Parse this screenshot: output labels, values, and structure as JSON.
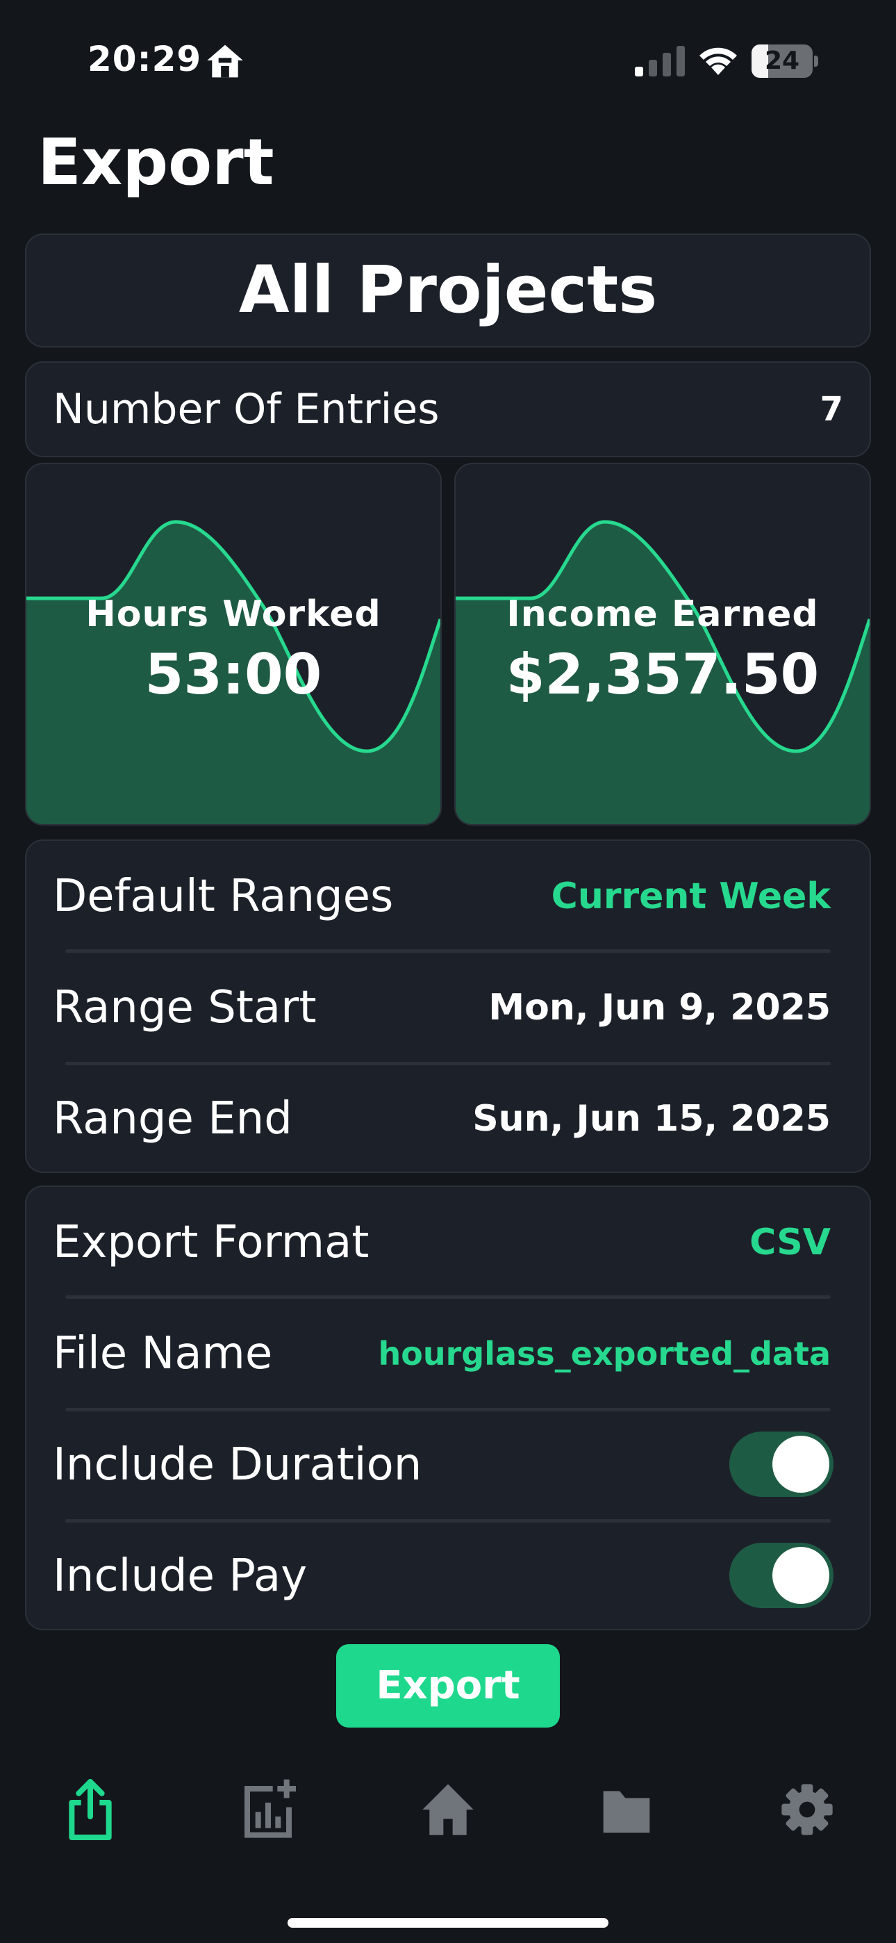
{
  "status_bar": {
    "time": "20:29",
    "battery_level": "24"
  },
  "page_title": "Export",
  "project_selector": {
    "title": "All Projects"
  },
  "entries": {
    "label": "Number Of Entries",
    "value": "7"
  },
  "stats": [
    {
      "label": "Hours Worked",
      "value": "53:00"
    },
    {
      "label": "Income Earned",
      "value": "$2,357.50"
    }
  ],
  "range": {
    "default_label": "Default Ranges",
    "default_value": "Current Week",
    "start_label": "Range Start",
    "start_value": "Mon, Jun 9, 2025",
    "end_label": "Range End",
    "end_value": "Sun, Jun 15, 2025"
  },
  "export_options": {
    "format_label": "Export Format",
    "format_value": "CSV",
    "file_label": "File Name",
    "file_value": "hourglass_exported_data",
    "duration_label": "Include Duration",
    "duration_on": true,
    "pay_label": "Include Pay",
    "pay_on": true
  },
  "export_button": "Export",
  "tab_bar": [
    {
      "icon": "share-icon",
      "active": true
    },
    {
      "icon": "add-chart-icon",
      "active": false
    },
    {
      "icon": "home-icon",
      "active": false
    },
    {
      "icon": "folder-icon",
      "active": false
    },
    {
      "icon": "gear-icon",
      "active": false
    }
  ],
  "colors": {
    "accent": "#1ed88d",
    "background": "#13171c",
    "card": "#1c2129",
    "chart_fill": "#1e5b45"
  }
}
